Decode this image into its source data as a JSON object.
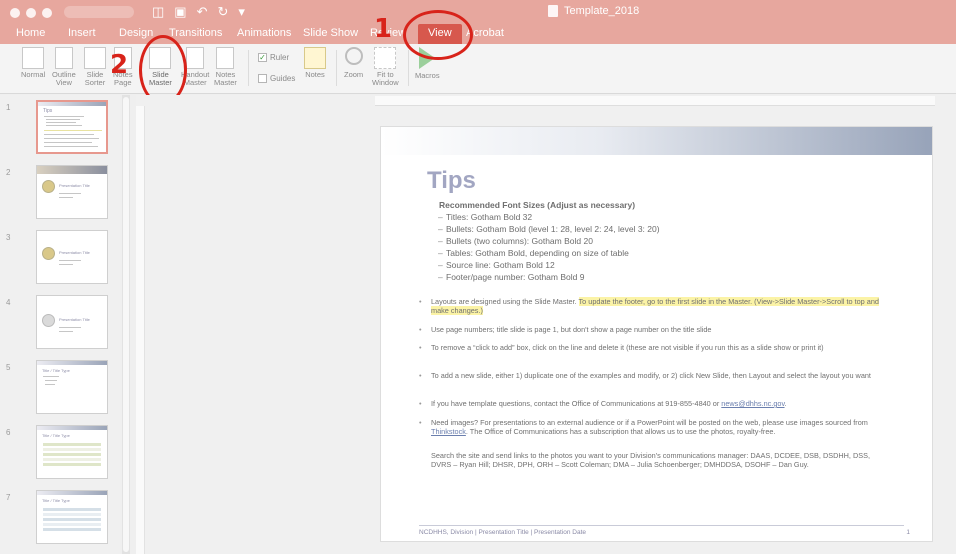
{
  "titlebar": {
    "document_title": "Template_2018"
  },
  "tabs": [
    "Home",
    "Insert",
    "Design",
    "Transitions",
    "Animations",
    "Slide Show",
    "Review",
    "View",
    "Acrobat"
  ],
  "ribbon": {
    "views": [
      {
        "label": "Normal"
      },
      {
        "label": "Outline\nView"
      },
      {
        "label": "Slide\nSorter"
      },
      {
        "label": "Notes\nPage"
      },
      {
        "label": "Slide\nMaster"
      },
      {
        "label": "Handout\nMaster"
      },
      {
        "label": "Notes\nMaster"
      }
    ],
    "ruler_label": "Ruler",
    "guides_label": "Guides",
    "notes_label": "Notes",
    "zoom_label": "Zoom",
    "fit_label": "Fit to\nWindow",
    "macros_label": "Macros"
  },
  "annotations": {
    "step1": "1",
    "step2": "2"
  },
  "thumbnails": {
    "numbers": [
      "1",
      "2",
      "3",
      "4",
      "5",
      "6",
      "7"
    ],
    "thumb1_title": "Tips",
    "thumb2_title": "Presentation Title",
    "thumb3_title": "Presentation Title",
    "thumb4_title": "Presentation Title",
    "thumb5_title": "Title / Title Type",
    "thumb6_title": "Title / Title Type",
    "thumb7_title": "Title / Title Type"
  },
  "slide": {
    "title": "Tips",
    "rec_head": "Recommended Font Sizes (Adjust as necessary)",
    "rec_items": [
      "Titles: Gotham Bold 32",
      "Bullets: Gotham Bold (level 1: 28, level 2: 24, level 3: 20)",
      "Bullets (two columns): Gotham Bold 20",
      "Tables: Gotham Bold, depending on size of table",
      "Source line: Gotham Bold 12",
      "Footer/page number: Gotham Bold 9"
    ],
    "b1_plain": "Layouts are designed using the Slide Master. ",
    "b1_highlight": "To update the footer, go to the first slide in the Master. (View->Slide Master->Scroll to top and make changes.)",
    "b2": "Use page numbers; title slide is page 1, but don't show a page number on the title slide",
    "b3": "To remove a “click to add” box, click on the line and delete it (these are not visible if you run this as a slide show or print it)",
    "b4": "To add a new slide, either 1) duplicate one of the examples and modify, or 2) click New Slide, then Layout and select the layout you want",
    "b5_plain": "If you have template questions, contact the Office of Communications at 919-855-4840 or ",
    "b5_link": "news@dhhs.nc.gov",
    "b5_end": ".",
    "b6_a": "Need images? For presentations to an external audience or if a PowerPoint will be posted on the web, please use images sourced from ",
    "b6_link": "Thinkstock",
    "b6_b": ". The Office of Communications has a subscription that allows us to use the photos, royalty-free.",
    "b7": "Search the site and send links to the photos you want to your Division's communications manager: DAAS, DCDEE, DSB, DSDHH, DSS, DVRS – Ryan Hill; DHSR, DPH, ORH – Scott Coleman; DMA – Julia Schoenberger;  DMHDDSA, DSOHF – Dan Guy.",
    "footer": "NCDHHS, Division | Presentation Title | Presentation Date",
    "page_number": "1"
  },
  "colors": {
    "accent": "#d7584d",
    "ribbon_bg": "#e7a79e",
    "annotation": "#d8231a",
    "slide_title": "#a2a6c2"
  }
}
